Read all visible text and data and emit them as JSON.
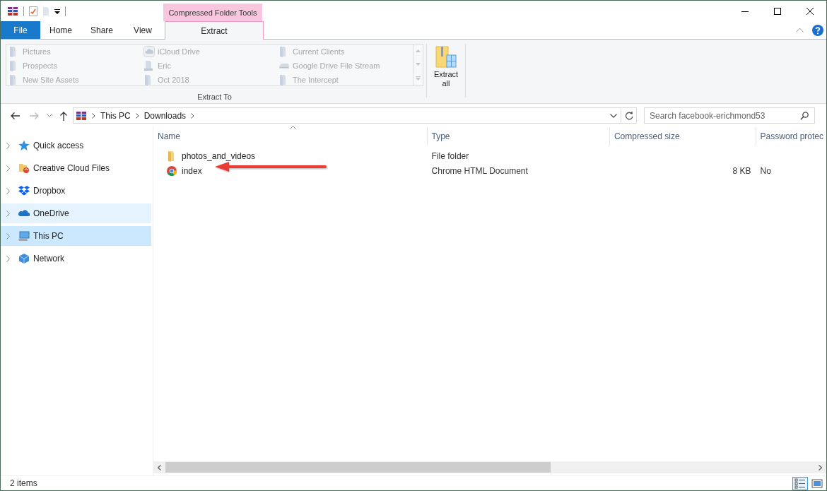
{
  "title_bar": {
    "contextual_group": "Compressed Folder Tools"
  },
  "ribbon": {
    "tabs": [
      {
        "label": "File",
        "kind": "file",
        "selected": false
      },
      {
        "label": "Home",
        "kind": "tab",
        "selected": false
      },
      {
        "label": "Share",
        "kind": "tab",
        "selected": false
      },
      {
        "label": "View",
        "kind": "tab",
        "selected": false
      },
      {
        "label": "Extract",
        "kind": "contextual",
        "selected": true
      }
    ],
    "extract_to": {
      "items": [
        {
          "label": "Pictures",
          "kind": "folder",
          "disabled": true
        },
        {
          "label": "Prospects",
          "kind": "folder",
          "disabled": true
        },
        {
          "label": "New Site Assets",
          "kind": "folder",
          "disabled": true
        },
        {
          "label": "iCloud Drive",
          "kind": "cloud",
          "disabled": true
        },
        {
          "label": "Eric",
          "kind": "user",
          "disabled": true
        },
        {
          "label": "Oct 2018",
          "kind": "folder",
          "disabled": true
        },
        {
          "label": "Current Clients",
          "kind": "folder",
          "disabled": true
        },
        {
          "label": "Google Drive File Stream",
          "kind": "drive",
          "disabled": true
        },
        {
          "label": "The Intercept",
          "kind": "folder",
          "disabled": true
        }
      ],
      "group_label": "Extract To"
    },
    "extract_all": {
      "label": "Extract all"
    }
  },
  "address_bar": {
    "breadcrumb": [
      "This PC",
      "Downloads"
    ]
  },
  "search": {
    "placeholder": "Search facebook-erichmond53"
  },
  "navigation_pane": {
    "items": [
      {
        "label": "Quick access",
        "kind": "star",
        "selected": false,
        "hovered": false
      },
      {
        "label": "Creative Cloud Files",
        "kind": "creative_cloud",
        "selected": false,
        "hovered": false
      },
      {
        "label": "Dropbox",
        "kind": "dropbox",
        "selected": false,
        "hovered": false
      },
      {
        "label": "OneDrive",
        "kind": "onedrive",
        "selected": false,
        "hovered": true
      },
      {
        "label": "This PC",
        "kind": "pc",
        "selected": true,
        "hovered": false
      },
      {
        "label": "Network",
        "kind": "network",
        "selected": false,
        "hovered": false
      }
    ]
  },
  "file_list": {
    "columns": [
      {
        "label": "Name",
        "sorted": true
      },
      {
        "label": "Type",
        "sorted": false
      },
      {
        "label": "Compressed size",
        "sorted": false
      },
      {
        "label": "Password protec",
        "sorted": false
      }
    ],
    "rows": [
      {
        "name": "photos_and_videos",
        "kind": "folder",
        "type": "File folder"
      },
      {
        "name": "index",
        "kind": "chrome",
        "type": "Chrome HTML Document",
        "compressed_size": "8 KB",
        "password_protected": "No"
      }
    ]
  },
  "status_bar": {
    "item_count": "2 items",
    "view_buttons": [
      {
        "kind": "details",
        "selected": true
      },
      {
        "kind": "large_icons",
        "selected": false
      }
    ]
  }
}
